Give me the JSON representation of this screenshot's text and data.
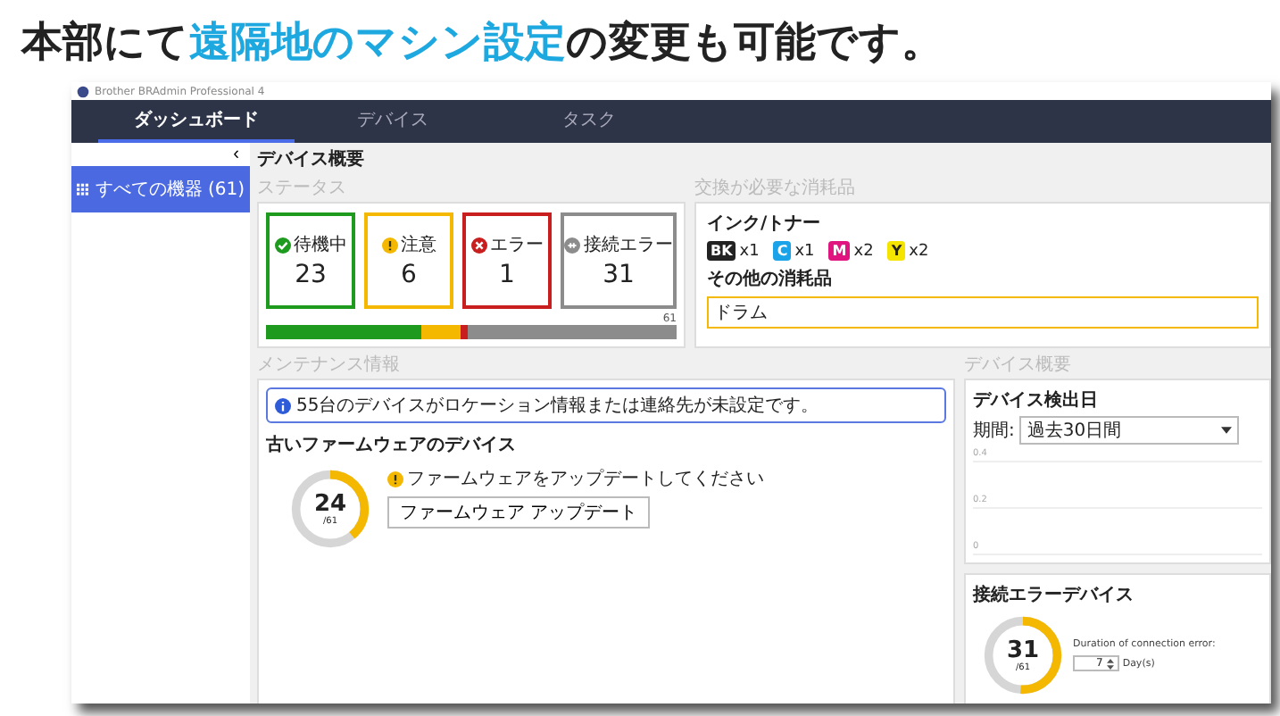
{
  "headline": [
    {
      "text": "本部にて",
      "highlight": false
    },
    {
      "text": "遠隔地のマシン設定",
      "highlight": true
    },
    {
      "text": "の変更も可能です。",
      "highlight": false
    }
  ],
  "window": {
    "title": "Brother BRAdmin Professional 4"
  },
  "tabs": [
    {
      "label": "ダッシュボード",
      "selected": true
    },
    {
      "label": "デバイス",
      "selected": false
    },
    {
      "label": "タスク",
      "selected": false
    }
  ],
  "sidebar": {
    "collapse": "‹",
    "items": [
      {
        "label": "すべての機器 (61)",
        "selected": true
      }
    ]
  },
  "page_title": "デバイス概要",
  "status": {
    "label": "ステータス",
    "total": "61",
    "items": [
      {
        "kind": "ok",
        "label": "待機中",
        "count": "23",
        "color": "#1e9a1e"
      },
      {
        "kind": "warning",
        "label": "注意",
        "count": "6",
        "color": "#f5b800"
      },
      {
        "kind": "error",
        "label": "エラー",
        "count": "1",
        "color": "#c81e1e"
      },
      {
        "kind": "offline",
        "label": "接続エラー",
        "count": "31",
        "color": "#8c8c8c"
      }
    ]
  },
  "consumables": {
    "label": "交換が必要な消耗品",
    "ink_label": "インク/トナー",
    "inks": [
      {
        "code": "BK",
        "count": "x1",
        "color": "#222222"
      },
      {
        "code": "C",
        "count": "x1",
        "color": "#1aa3e8"
      },
      {
        "code": "M",
        "count": "x2",
        "color": "#e0157f"
      },
      {
        "code": "Y",
        "count": "x2",
        "color": "#f5e400"
      }
    ],
    "other_label": "その他の消耗品",
    "other_value": "ドラム"
  },
  "maintenance": {
    "label": "メンテナンス情報",
    "notice": "55台のデバイスがロケーション情報または連絡先が未設定です。",
    "firmware_title": "古いファームウェアのデバイス",
    "count": "24",
    "total": "/61",
    "level": 0.39,
    "warning": "ファームウェアをアップデートしてください",
    "button": "ファームウェア アップデート"
  },
  "overview": {
    "label": "デバイス概要",
    "chart_title": "デバイス検出日",
    "period_label": "期間:",
    "period_value": "過去30日間",
    "y_ticks": [
      "0.4",
      "0.2",
      "0"
    ],
    "errors_title": "接続エラーデバイス",
    "count": "31",
    "total": "/61",
    "level": 0.51,
    "duration_label": "Duration of connection error:",
    "duration_value": "7",
    "duration_unit": "Day(s)"
  }
}
